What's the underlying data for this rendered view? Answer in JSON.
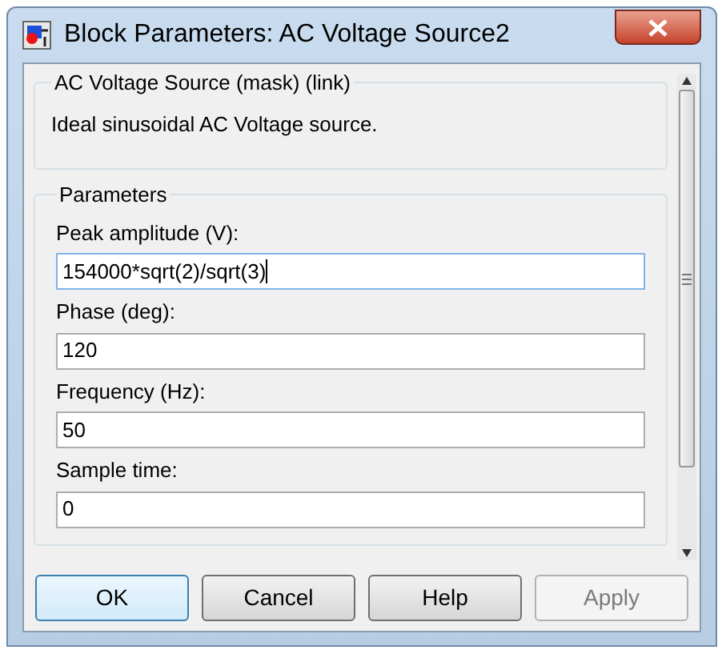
{
  "window": {
    "title": "Block Parameters: AC Voltage Source2"
  },
  "description_group": {
    "title": "AC Voltage Source (mask) (link)",
    "text": "Ideal sinusoidal AC Voltage source."
  },
  "parameters_group": {
    "title": "Parameters",
    "fields": [
      {
        "label": "Peak amplitude (V):",
        "value": "154000*sqrt(2)/sqrt(3)",
        "focused": true
      },
      {
        "label": "Phase (deg):",
        "value": "120",
        "focused": false
      },
      {
        "label": "Frequency (Hz):",
        "value": "50",
        "focused": false
      },
      {
        "label": "Sample time:",
        "value": "0",
        "focused": false
      }
    ]
  },
  "buttons": [
    {
      "label": "OK",
      "default": true,
      "disabled": false
    },
    {
      "label": "Cancel",
      "default": false,
      "disabled": false
    },
    {
      "label": "Help",
      "default": false,
      "disabled": false
    },
    {
      "label": "Apply",
      "default": false,
      "disabled": true
    }
  ]
}
